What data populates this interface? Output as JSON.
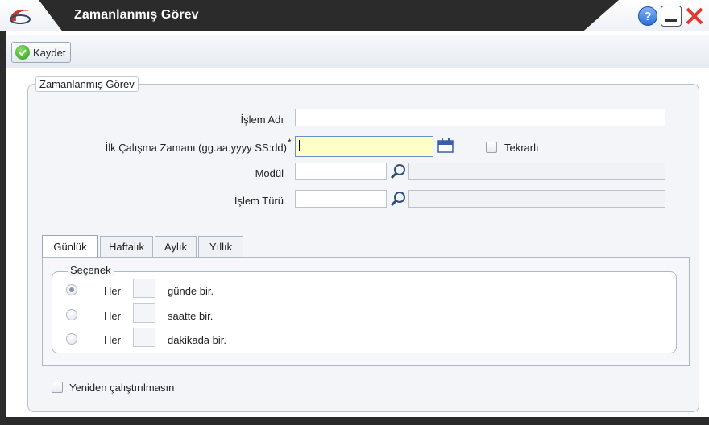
{
  "window": {
    "title": "Zamanlanmış Görev",
    "help_label": "?"
  },
  "toolbar": {
    "save_label": "Kaydet"
  },
  "form": {
    "legend": "Zamanlanmış Görev",
    "islem_adi_label": "İşlem Adı",
    "islem_adi_value": "",
    "ilk_calisma_label": "İlk Çalışma Zamanı (gg.aa.yyyy SS:dd)",
    "required_mark": "*",
    "ilk_calisma_value": "",
    "tekrarli_label": "Tekrarlı",
    "modul_label": "Modül",
    "islem_turu_label": "İşlem Türü"
  },
  "tabs": [
    "Günlük",
    "Haftalık",
    "Aylık",
    "Yıllık"
  ],
  "options": {
    "legend": "Seçenek",
    "rows": [
      {
        "prefix": "Her",
        "suffix": "günde bir.",
        "selected": true
      },
      {
        "prefix": "Her",
        "suffix": "saatte bir.",
        "selected": false
      },
      {
        "prefix": "Her",
        "suffix": "dakikada bir.",
        "selected": false
      }
    ]
  },
  "footer": {
    "no_rerun_label": "Yeniden çalıştırılmasın"
  },
  "colors": {
    "title_bg": "#2b2b2b",
    "focus_bg": "#ffffc8",
    "panel_bg": "#f3f5f8"
  }
}
